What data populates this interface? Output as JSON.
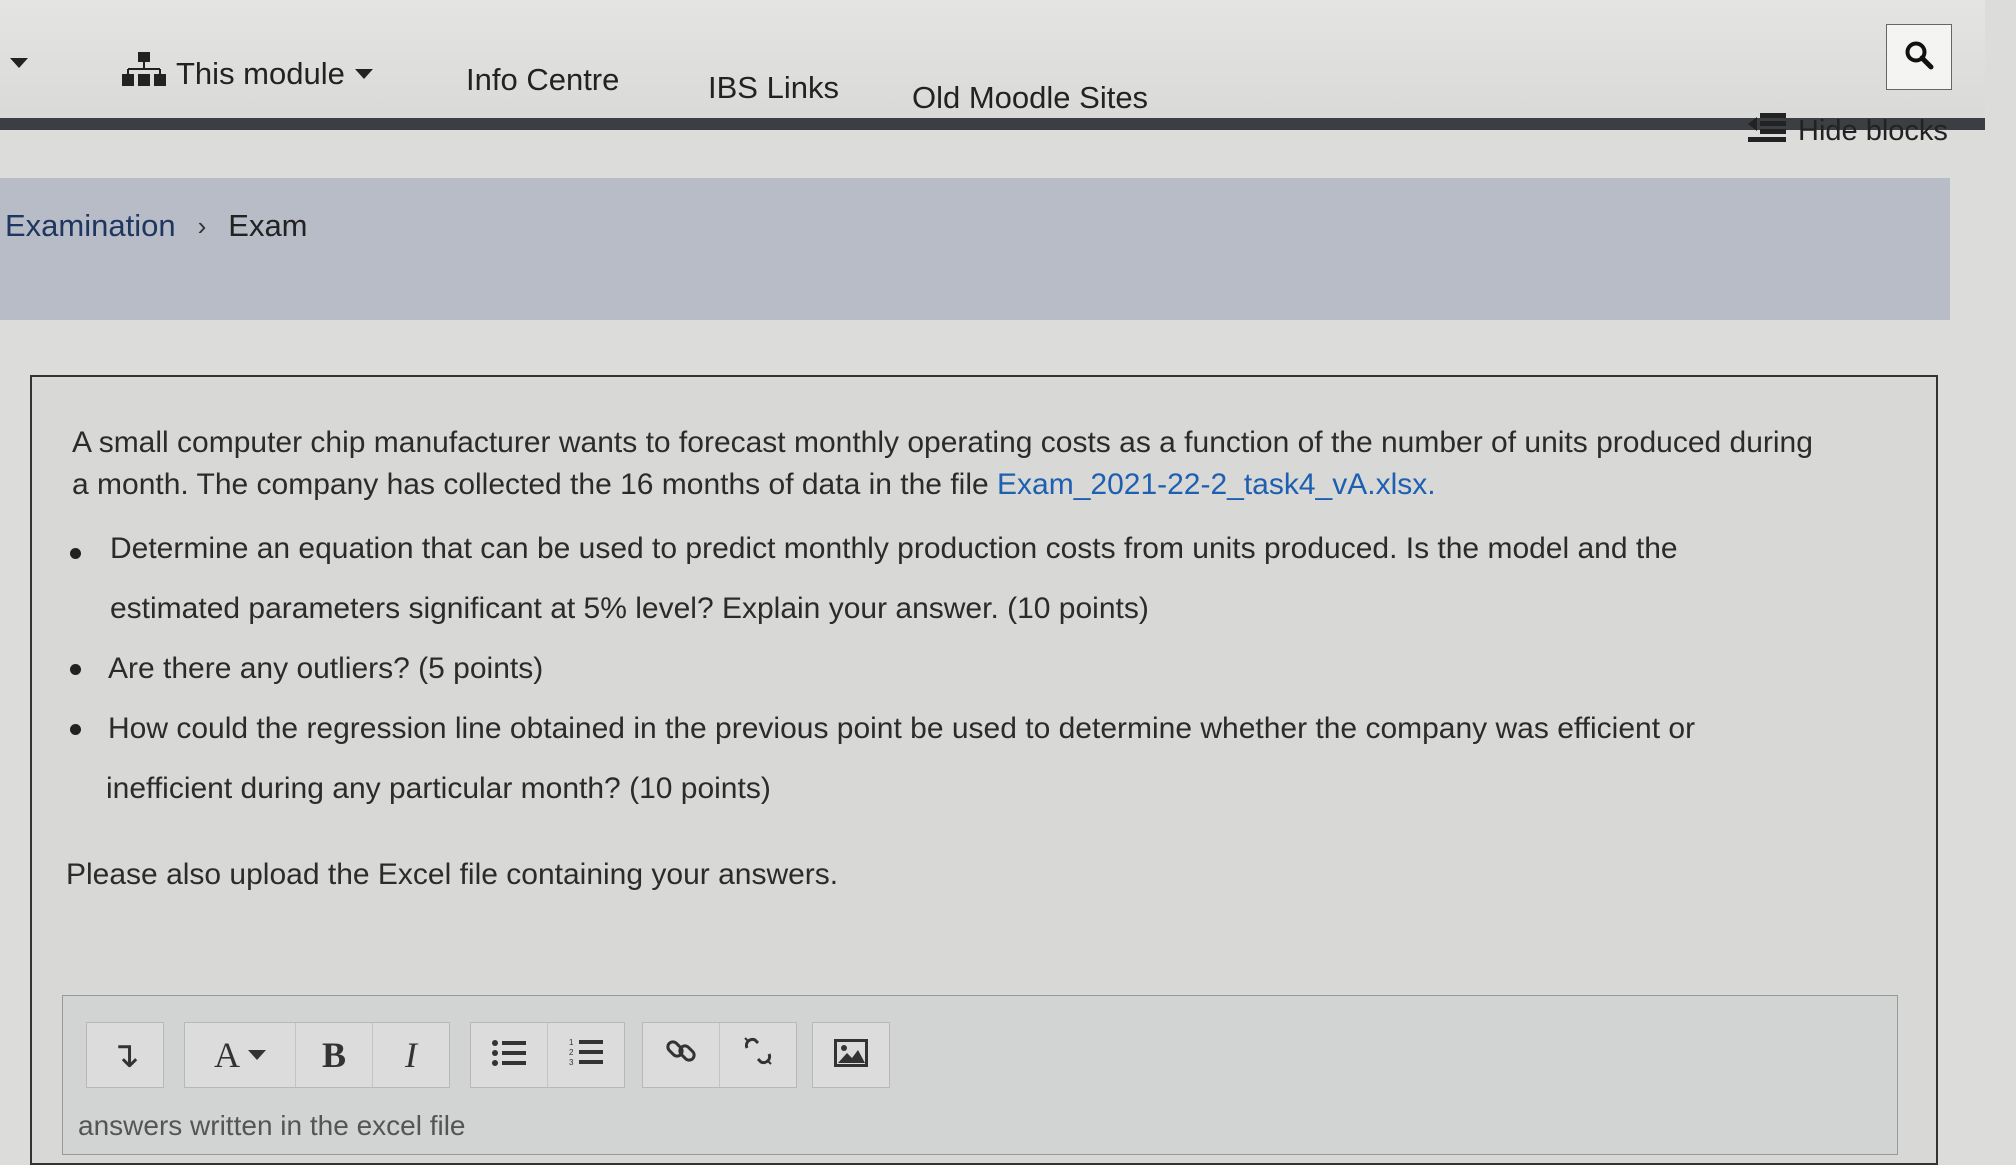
{
  "nav": {
    "items": [
      {
        "label": "This module",
        "icon": "sitemap-icon",
        "has_caret": true
      },
      {
        "label": "Info Centre"
      },
      {
        "label": "IBS Links"
      },
      {
        "label": "Old Moodle Sites"
      }
    ],
    "hide_blocks_label": "Hide blocks",
    "search_icon": "search-icon"
  },
  "breadcrumb": {
    "items": [
      "Examination",
      "Exam"
    ],
    "separator": "›"
  },
  "question": {
    "intro": "A small computer chip manufacturer wants to forecast monthly operating costs as a function of the number of units produced during a month. The company has collected the 16 months of data in the file ",
    "file_link": "Exam_2021-22-2_task4_vA.xlsx",
    "intro_end": ".",
    "bullets": [
      {
        "line1": "Determine an equation that can be used to predict monthly production costs from units produced. Is the model and the",
        "line2": "estimated parameters significant at 5% level? Explain your answer. (10 points)"
      },
      {
        "line1": "Are there any outliers? (5 points)"
      },
      {
        "line1": "How could the regression line obtained in the previous point be used to determine whether the company was efficient or",
        "line2": "inefficient during any particular month? (10 points)"
      }
    ],
    "footer": "Please also upload the Excel file containing your answers."
  },
  "editor": {
    "toolbar": {
      "collapse": "↴",
      "font": "A",
      "bold": "B",
      "italic": "I",
      "unordered_list": "☰",
      "ordered_list": "☷"
    },
    "content": "answers written in the excel file"
  },
  "colors": {
    "link": "#1d5fb0",
    "breadcrumb_bar": "#b7bcc7",
    "nav_dark_line": "#3b3f44"
  }
}
